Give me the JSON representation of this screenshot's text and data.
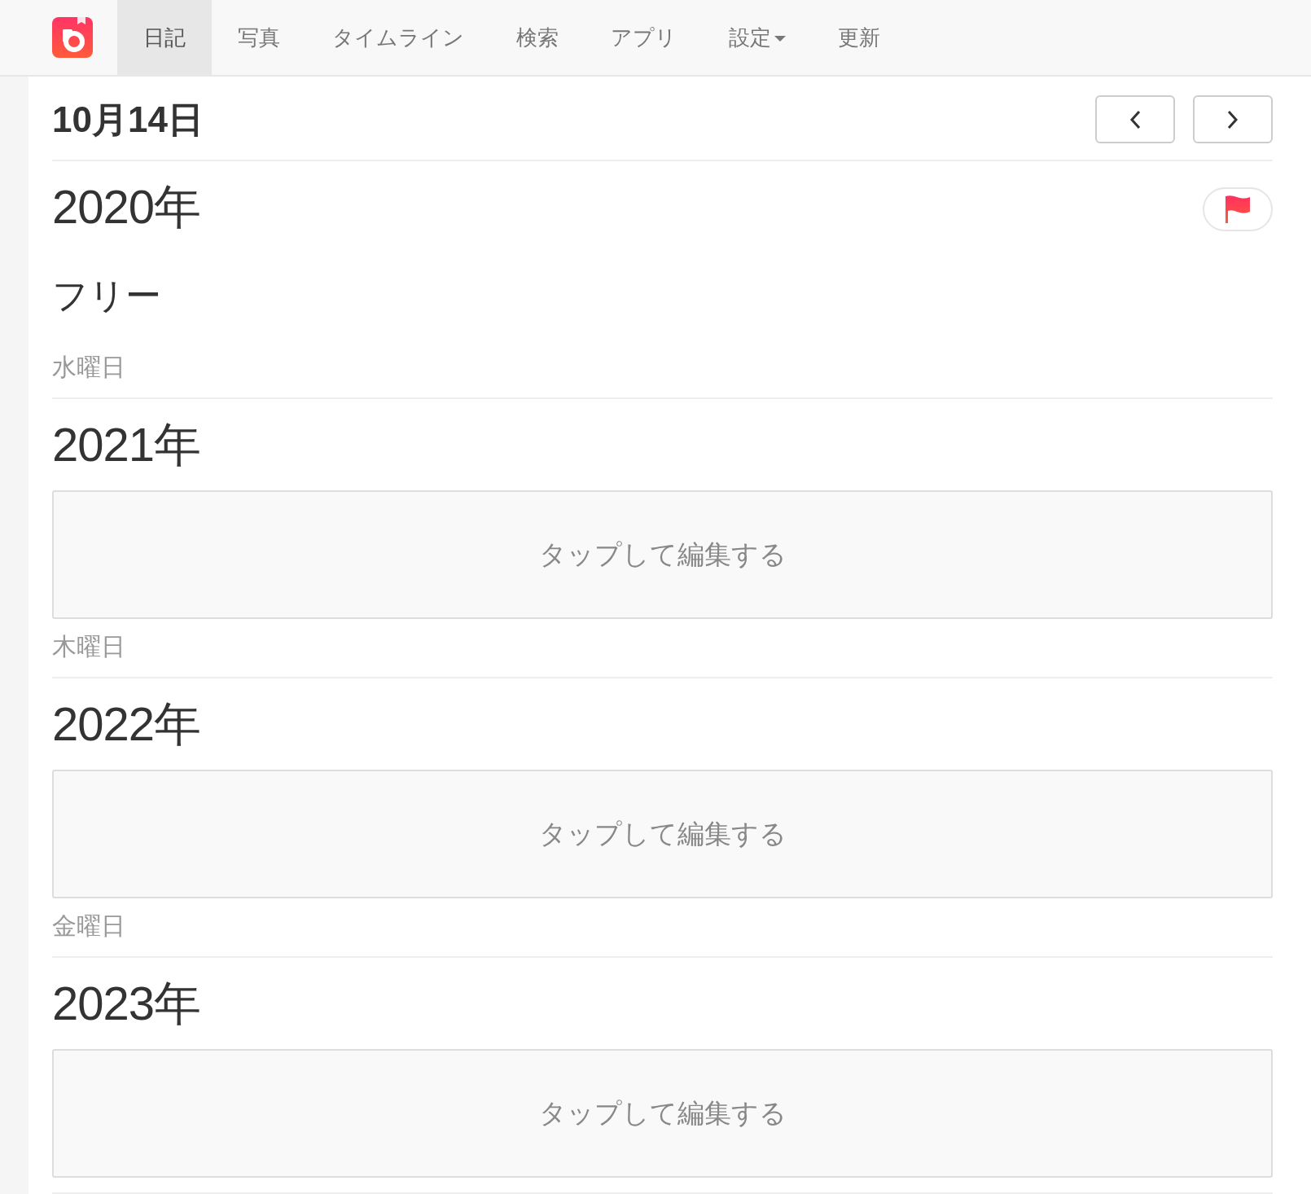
{
  "nav": {
    "items": [
      {
        "label": "日記",
        "selected": true,
        "dropdown": false
      },
      {
        "label": "写真",
        "selected": false,
        "dropdown": false
      },
      {
        "label": "タイムライン",
        "selected": false,
        "dropdown": false
      },
      {
        "label": "検索",
        "selected": false,
        "dropdown": false
      },
      {
        "label": "アプリ",
        "selected": false,
        "dropdown": false
      },
      {
        "label": "設定",
        "selected": false,
        "dropdown": true
      },
      {
        "label": "更新",
        "selected": false,
        "dropdown": false
      }
    ]
  },
  "header": {
    "date": "10月14日"
  },
  "entries": [
    {
      "year": "2020年",
      "flagged": true,
      "kind": "text",
      "text": "フリー",
      "weekday": "水曜日"
    },
    {
      "year": "2021年",
      "flagged": false,
      "kind": "empty",
      "hint": "タップして編集する",
      "weekday": "木曜日"
    },
    {
      "year": "2022年",
      "flagged": false,
      "kind": "empty",
      "hint": "タップして編集する",
      "weekday": "金曜日"
    },
    {
      "year": "2023年",
      "flagged": false,
      "kind": "empty",
      "hint": "タップして編集する"
    }
  ]
}
